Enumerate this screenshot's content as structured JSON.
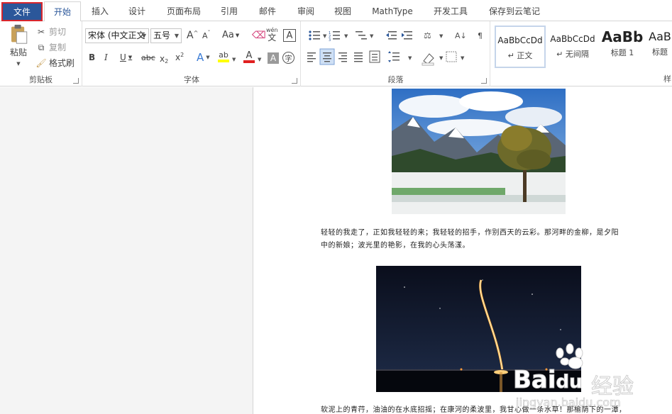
{
  "tabs": {
    "file": "文件",
    "home": "开始",
    "insert": "插入",
    "design": "设计",
    "layout": "页面布局",
    "references": "引用",
    "mailings": "邮件",
    "review": "审阅",
    "view": "视图",
    "mathtype": "MathType",
    "developer": "开发工具",
    "cloud": "保存到云笔记"
  },
  "clipboard": {
    "paste": "粘贴",
    "cut": "剪切",
    "copy": "复制",
    "format_painter": "格式刷",
    "label": "剪贴板"
  },
  "font": {
    "name": "宋体 (中文正文",
    "size": "五号",
    "label": "字体",
    "grow": "A",
    "shrink": "A",
    "case": "Aa",
    "pinyin_top": "wén",
    "pinyin_bottom": "文",
    "border_char": "A",
    "bold": "B",
    "italic": "I",
    "underline": "U",
    "strike": "abc",
    "subscript": "x",
    "subscript_mark": "2",
    "superscript": "x",
    "superscript_mark": "2",
    "effects": "A",
    "highlight": "ab",
    "color": "A",
    "shade": "A",
    "enclose": "字"
  },
  "paragraph": {
    "label": "段落"
  },
  "styles": {
    "label": "样",
    "items": [
      {
        "sample": "AaBbCcDd",
        "name": "↵ 正文"
      },
      {
        "sample": "AaBbCcDd",
        "name": "↵ 无间隔"
      },
      {
        "sample": "AaBb",
        "name": "标题 1"
      },
      {
        "sample": "AaB",
        "name": "标题"
      }
    ]
  },
  "document": {
    "para1_line1": "轻轻的我走了，正如我轻轻的来；我轻轻的招手，作别西天的云彩。那河畔的金柳，是夕阳",
    "para1_line2": "中的新娘；波光里的艳影，在我的心头荡漾。",
    "para2_line1": "软泥上的青荇，油油的在水底招摇；在康河的柔波里，我甘心做一条水草！那榆荫下的一潭，"
  },
  "watermark": {
    "brand": "Bai",
    "brand2": "du",
    "cn": "经验",
    "url": "jingyan.baidu.com"
  }
}
